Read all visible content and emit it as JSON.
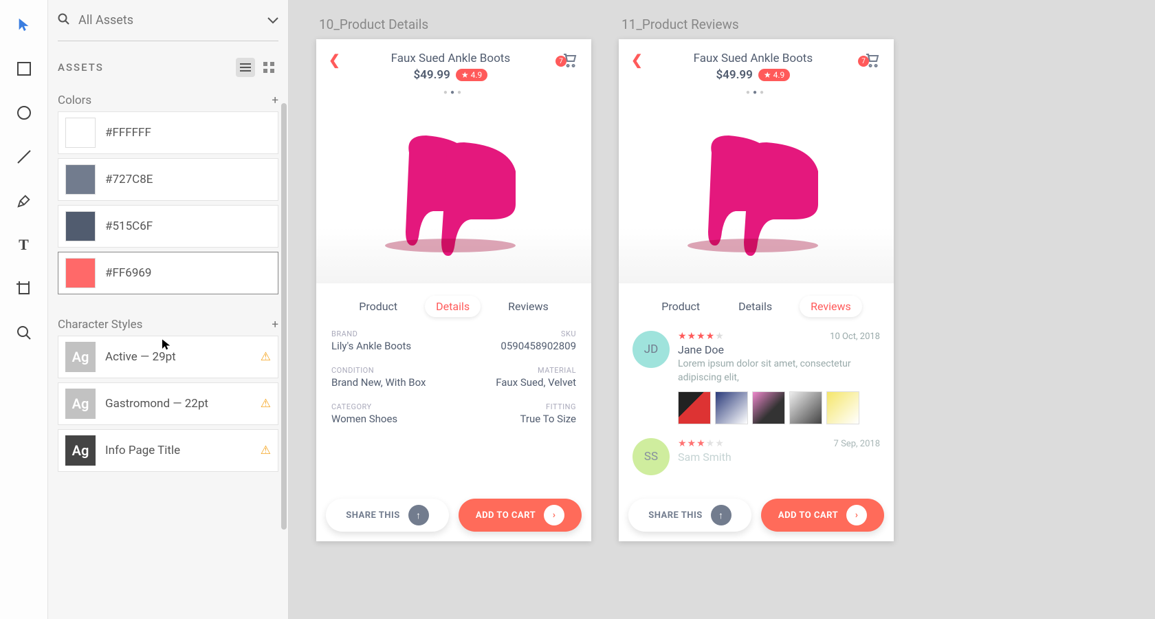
{
  "search": {
    "placeholder": "All Assets"
  },
  "panel": {
    "heading": "ASSETS",
    "sections": {
      "colors": {
        "title": "Colors",
        "items": [
          {
            "hex": "#FFFFFF",
            "label": "#FFFFFF"
          },
          {
            "hex": "#727C8E",
            "label": "#727C8E"
          },
          {
            "hex": "#515C6F",
            "label": "#515C6F"
          },
          {
            "hex": "#FF6969",
            "label": "#FF6969"
          }
        ]
      },
      "char_styles": {
        "title": "Character Styles",
        "items": [
          {
            "label": "Active — 29pt"
          },
          {
            "label": "Gastromond — 22pt"
          },
          {
            "label": "Info Page Title"
          }
        ]
      }
    }
  },
  "artboards": [
    {
      "title": "10_Product Details",
      "product": {
        "name": "Faux Sued Ankle Boots",
        "price": "$49.99",
        "rating": "4.9",
        "cart_badge": "7"
      },
      "tabs": [
        "Product",
        "Details",
        "Reviews"
      ],
      "active_tab": 1,
      "details": [
        {
          "l_label": "BRAND",
          "l_val": "Lily's Ankle Boots",
          "r_label": "SKU",
          "r_val": "0590458902809"
        },
        {
          "l_label": "CONDITION",
          "l_val": "Brand New, With Box",
          "r_label": "MATERIAL",
          "r_val": "Faux Sued, Velvet"
        },
        {
          "l_label": "CATEGORY",
          "l_val": "Women Shoes",
          "r_label": "FITTING",
          "r_val": "True To Size"
        }
      ],
      "share": "SHARE THIS",
      "add": "ADD TO CART"
    },
    {
      "title": "11_Product Reviews",
      "product": {
        "name": "Faux Sued Ankle Boots",
        "price": "$49.99",
        "rating": "4.9",
        "cart_badge": "7"
      },
      "tabs": [
        "Product",
        "Details",
        "Reviews"
      ],
      "active_tab": 2,
      "reviews": [
        {
          "initials": "JD",
          "avatar_bg": "#9fe3dc",
          "stars": 4,
          "date": "10 Oct, 2018",
          "name": "Jane Doe",
          "text": "Lorem ipsum dolor sit amet, consectetur adipiscing elit,"
        },
        {
          "initials": "SS",
          "avatar_bg": "#c7ea8e",
          "stars": 3,
          "date": "7 Sep, 2018",
          "name": "Sam Smith",
          "text": ""
        }
      ],
      "share": "SHARE THIS",
      "add": "ADD TO CART"
    }
  ]
}
